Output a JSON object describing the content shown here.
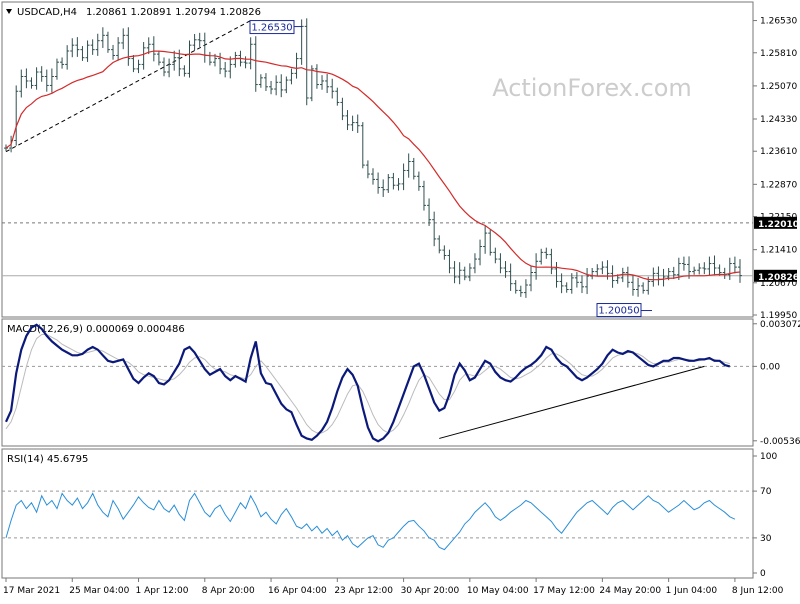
{
  "header": {
    "symbol": "USDCAD,H4",
    "ohlc": "1.20861 1.20891 1.20794 1.20826"
  },
  "watermark": "ActionForex.com",
  "colors": {
    "candle": "#2f4f4f",
    "ma": "#d42a2a",
    "macd": "#0b1a7a",
    "signal": "#bbbbbb",
    "rsi": "#2a8fd8",
    "trendline": "#000000",
    "level_line": "#777777",
    "price_tag_bg": "#000000",
    "price_tag_fg": "#ffffff",
    "annotation": "#1a2a9a",
    "grid": "#999999"
  },
  "chart_data": [
    {
      "type": "candlestick",
      "name": "price-panel",
      "ylim": [
        1.1995,
        1.269
      ],
      "ytick_labels": [
        "1.26530",
        "1.25810",
        "1.25070",
        "1.24330",
        "1.23610",
        "1.22870",
        "1.22150",
        "1.21410",
        "1.20670",
        "1.19950"
      ],
      "ytick_values": [
        1.2653,
        1.2581,
        1.2507,
        1.2433,
        1.2361,
        1.2287,
        1.2215,
        1.2141,
        1.2067,
        1.1995
      ],
      "last_price_label": "1.20826",
      "last_price": 1.20826,
      "level_label": "1.22010",
      "level": 1.2201,
      "annotations": [
        {
          "label": "1.26530",
          "value": 1.2653
        },
        {
          "label": "1.20050",
          "value": 1.2005
        }
      ],
      "trendline": {
        "from": [
          0,
          1.236
        ],
        "to": [
          48,
          1.2653
        ]
      },
      "close_path": [
        1.2368,
        1.2385,
        1.2495,
        1.2528,
        1.2518,
        1.2508,
        1.2538,
        1.2528,
        1.2508,
        1.2528,
        1.256,
        1.2555,
        1.2585,
        1.2598,
        1.2588,
        1.257,
        1.2598,
        1.2588,
        1.2608,
        1.262,
        1.2588,
        1.2575,
        1.2603,
        1.262,
        1.2568,
        1.2545,
        1.2555,
        1.2592,
        1.26,
        1.2578,
        1.256,
        1.2538,
        1.2555,
        1.257,
        1.2545,
        1.2535,
        1.2598,
        1.261,
        1.2608,
        1.2575,
        1.256,
        1.2568,
        1.2545,
        1.254,
        1.2555,
        1.2575,
        1.256,
        1.2558,
        1.26,
        1.251,
        1.2525,
        1.2505,
        1.25,
        1.2515,
        1.2498,
        1.252,
        1.2535,
        1.2568,
        1.264,
        1.248,
        1.2545,
        1.251,
        1.2518,
        1.2505,
        1.2495,
        1.247,
        1.244,
        1.242,
        1.2425,
        1.2418,
        1.233,
        1.231,
        1.2298,
        1.228,
        1.2275,
        1.2302,
        1.2285,
        1.2288,
        1.2318,
        1.2338,
        1.2305,
        1.2282,
        1.224,
        1.2208,
        1.2165,
        1.214,
        1.2128,
        1.21,
        1.208,
        1.2095,
        1.208,
        1.21,
        1.212,
        1.2148,
        1.2178,
        1.2135,
        1.212,
        1.21,
        1.2092,
        1.2065,
        1.205,
        1.2045,
        1.2062,
        1.209,
        1.2115,
        1.2135,
        1.213,
        1.2098,
        1.207,
        1.206,
        1.2052,
        1.2078,
        1.2068,
        1.2058,
        1.2082,
        1.2092,
        1.2098,
        1.2102,
        1.2088,
        1.2072,
        1.2078,
        1.209,
        1.2068,
        1.2052,
        1.206,
        1.205,
        1.207,
        1.2088,
        1.2075,
        1.208,
        1.2092,
        1.2085,
        1.211,
        1.2108,
        1.2092,
        1.2095,
        1.21,
        1.2098,
        1.211,
        1.21,
        1.209,
        1.2085,
        1.211,
        1.2102,
        1.2083
      ]
    },
    {
      "type": "line",
      "name": "macd-panel",
      "title": "MACD(12,26,9) 0.000069 0.000486",
      "ylim": [
        -0.0056,
        0.0032
      ],
      "ytick_labels": [
        "0.003072",
        "0.00",
        "-0.005369"
      ],
      "ytick_values": [
        0.003072,
        0.0,
        -0.005369
      ],
      "macd": [
        -0.004,
        -0.0032,
        -0.0005,
        0.0012,
        0.0022,
        0.0028,
        0.003,
        0.0027,
        0.0022,
        0.0018,
        0.0015,
        0.0012,
        0.001,
        0.0008,
        0.0008,
        0.0009,
        0.0012,
        0.0014,
        0.0012,
        0.0008,
        0.0004,
        0.0003,
        0.0004,
        0.0005,
        -0.0002,
        -0.0009,
        -0.0012,
        -0.0008,
        -0.0005,
        -0.0007,
        -0.0012,
        -0.0013,
        -0.001,
        -0.0004,
        0.0002,
        0.0012,
        0.0014,
        0.001,
        0.0004,
        -0.0002,
        -0.0006,
        -0.0004,
        -0.0002,
        -0.0007,
        -0.001,
        -0.0007,
        -0.0009,
        -0.0011,
        0.0006,
        0.0018,
        -0.0005,
        -0.0012,
        -0.0013,
        -0.002,
        -0.0027,
        -0.0031,
        -0.0033,
        -0.0042,
        -0.005,
        -0.0052,
        -0.0053,
        -0.005,
        -0.0046,
        -0.004,
        -0.003,
        -0.0018,
        -0.0008,
        -0.0002,
        -0.0006,
        -0.0014,
        -0.003,
        -0.0044,
        -0.0052,
        -0.0054,
        -0.0052,
        -0.0048,
        -0.004,
        -0.003,
        -0.002,
        -0.001,
        0.0,
        0.0002,
        -0.0006,
        -0.0016,
        -0.0026,
        -0.0032,
        -0.003,
        -0.002,
        -0.0006,
        0.0002,
        -0.0003,
        -0.001,
        -0.0008,
        -0.0002,
        0.0004,
        0.0002,
        -0.0004,
        -0.0008,
        -0.001,
        -0.0011,
        -0.0008,
        -0.0004,
        -0.0001,
        0.0001,
        0.0004,
        0.0008,
        0.0014,
        0.0012,
        0.0006,
        0.0002,
        0.0,
        -0.0004,
        -0.0008,
        -0.001,
        -0.0008,
        -0.0005,
        -0.0002,
        0.0002,
        0.0008,
        0.0012,
        0.001,
        0.0009,
        0.0011,
        0.001,
        0.0007,
        0.0004,
        0.0001,
        0.0,
        0.0002,
        0.0004,
        0.0004,
        0.0006,
        0.0006,
        0.0005,
        0.0004,
        0.0004,
        0.0005,
        0.0005,
        0.0006,
        0.0004,
        0.0004,
        0.0001,
        0.0
      ],
      "signal": [
        -0.0045,
        -0.004,
        -0.003,
        -0.0015,
        0.0,
        0.0012,
        0.002,
        0.0023,
        0.0023,
        0.0021,
        0.0019,
        0.0016,
        0.0014,
        0.0012,
        0.001,
        0.0009,
        0.001,
        0.0011,
        0.0012,
        0.0011,
        0.0009,
        0.0007,
        0.0005,
        0.0004,
        0.0003,
        0.0,
        -0.0004,
        -0.0006,
        -0.0007,
        -0.0008,
        -0.0009,
        -0.001,
        -0.001,
        -0.0009,
        -0.0006,
        -0.0002,
        0.0003,
        0.0006,
        0.0007,
        0.0005,
        0.0001,
        -0.0002,
        -0.0003,
        -0.0004,
        -0.0006,
        -0.0007,
        -0.0008,
        -0.0009,
        -0.0006,
        0.0,
        0.0004,
        0.0,
        -0.0005,
        -0.001,
        -0.0015,
        -0.002,
        -0.0025,
        -0.003,
        -0.0036,
        -0.0042,
        -0.0046,
        -0.0048,
        -0.0048,
        -0.0046,
        -0.0042,
        -0.0036,
        -0.0028,
        -0.002,
        -0.0014,
        -0.0013,
        -0.0018,
        -0.0026,
        -0.0035,
        -0.0042,
        -0.0046,
        -0.0048,
        -0.0046,
        -0.0042,
        -0.0035,
        -0.0027,
        -0.0018,
        -0.001,
        -0.0006,
        -0.0008,
        -0.0014,
        -0.002,
        -0.0024,
        -0.0024,
        -0.0018,
        -0.001,
        -0.0006,
        -0.0006,
        -0.0007,
        -0.0006,
        -0.0003,
        0.0,
        0.0,
        -0.0002,
        -0.0005,
        -0.0008,
        -0.0009,
        -0.0008,
        -0.0006,
        -0.0004,
        -0.0001,
        0.0002,
        0.0006,
        0.0009,
        0.0009,
        0.0007,
        0.0004,
        0.0001,
        -0.0003,
        -0.0006,
        -0.0007,
        -0.0007,
        -0.0005,
        -0.0002,
        0.0002,
        0.0006,
        0.0008,
        0.0009,
        0.001,
        0.001,
        0.0009,
        0.0007,
        0.0004,
        0.0002,
        0.0002,
        0.0003,
        0.0003,
        0.0004,
        0.0005,
        0.0005,
        0.0005,
        0.0004,
        0.0004,
        0.0005,
        0.0005,
        0.0005,
        0.0004,
        0.0003,
        0.0002
      ],
      "trendline": {
        "from": [
          85,
          -0.0052
        ],
        "to": [
          137,
          0.0
        ]
      }
    },
    {
      "type": "line",
      "name": "rsi-panel",
      "title": "RSI(14) 45.6795",
      "ylim": [
        0,
        100
      ],
      "ytick_labels": [
        "100",
        "70",
        "30",
        "0"
      ],
      "ytick_values": [
        100,
        70,
        30,
        0
      ],
      "levels": [
        70,
        30
      ],
      "values": [
        30,
        45,
        58,
        62,
        55,
        60,
        52,
        66,
        58,
        62,
        55,
        68,
        62,
        58,
        64,
        55,
        60,
        68,
        58,
        52,
        48,
        62,
        55,
        46,
        52,
        58,
        65,
        60,
        56,
        54,
        62,
        55,
        52,
        58,
        50,
        45,
        62,
        68,
        60,
        52,
        48,
        55,
        58,
        50,
        44,
        52,
        60,
        55,
        66,
        58,
        48,
        52,
        46,
        42,
        50,
        55,
        48,
        40,
        38,
        42,
        36,
        40,
        34,
        38,
        32,
        36,
        28,
        32,
        25,
        22,
        26,
        30,
        32,
        24,
        22,
        28,
        30,
        35,
        40,
        44,
        45,
        40,
        36,
        30,
        28,
        22,
        20,
        25,
        30,
        35,
        42,
        46,
        52,
        56,
        60,
        55,
        48,
        45,
        48,
        52,
        55,
        58,
        62,
        60,
        56,
        52,
        48,
        44,
        38,
        34,
        40,
        46,
        52,
        56,
        60,
        62,
        58,
        54,
        50,
        56,
        60,
        62,
        58,
        54,
        58,
        62,
        66,
        62,
        60,
        56,
        52,
        55,
        58,
        62,
        58,
        54,
        56,
        60,
        62,
        58,
        55,
        52,
        48,
        46
      ]
    }
  ],
  "x_axis": {
    "tick_labels": [
      "17 Mar 2021",
      "25 Mar 04:00",
      "1 Apr 12:00",
      "8 Apr 20:00",
      "16 Apr 04:00",
      "23 Apr 12:00",
      "30 Apr 20:00",
      "10 May 04:00",
      "17 May 12:00",
      "24 May 20:00",
      "1 Jun 04:00",
      "8 Jun 12:00"
    ],
    "tick_index": [
      0,
      13,
      26,
      39,
      52,
      65,
      78,
      91,
      104,
      117,
      130,
      143
    ]
  }
}
